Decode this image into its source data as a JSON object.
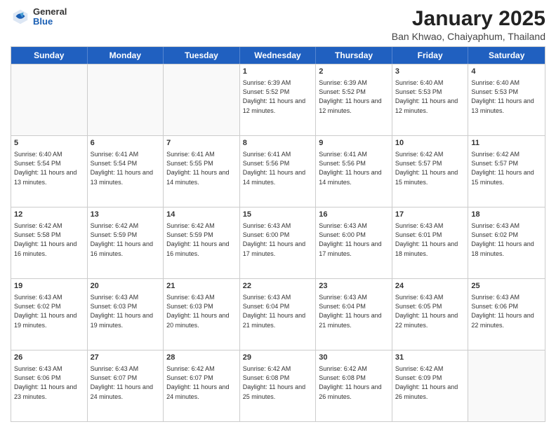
{
  "header": {
    "logo": {
      "general": "General",
      "blue": "Blue"
    },
    "title": "January 2025",
    "location": "Ban Khwao, Chaiyaphum, Thailand"
  },
  "days_of_week": [
    "Sunday",
    "Monday",
    "Tuesday",
    "Wednesday",
    "Thursday",
    "Friday",
    "Saturday"
  ],
  "weeks": [
    [
      {
        "day": "",
        "empty": true
      },
      {
        "day": "",
        "empty": true
      },
      {
        "day": "",
        "empty": true
      },
      {
        "day": "1",
        "sunrise": "Sunrise: 6:39 AM",
        "sunset": "Sunset: 5:52 PM",
        "daylight": "Daylight: 11 hours and 12 minutes."
      },
      {
        "day": "2",
        "sunrise": "Sunrise: 6:39 AM",
        "sunset": "Sunset: 5:52 PM",
        "daylight": "Daylight: 11 hours and 12 minutes."
      },
      {
        "day": "3",
        "sunrise": "Sunrise: 6:40 AM",
        "sunset": "Sunset: 5:53 PM",
        "daylight": "Daylight: 11 hours and 12 minutes."
      },
      {
        "day": "4",
        "sunrise": "Sunrise: 6:40 AM",
        "sunset": "Sunset: 5:53 PM",
        "daylight": "Daylight: 11 hours and 13 minutes."
      }
    ],
    [
      {
        "day": "5",
        "sunrise": "Sunrise: 6:40 AM",
        "sunset": "Sunset: 5:54 PM",
        "daylight": "Daylight: 11 hours and 13 minutes."
      },
      {
        "day": "6",
        "sunrise": "Sunrise: 6:41 AM",
        "sunset": "Sunset: 5:54 PM",
        "daylight": "Daylight: 11 hours and 13 minutes."
      },
      {
        "day": "7",
        "sunrise": "Sunrise: 6:41 AM",
        "sunset": "Sunset: 5:55 PM",
        "daylight": "Daylight: 11 hours and 14 minutes."
      },
      {
        "day": "8",
        "sunrise": "Sunrise: 6:41 AM",
        "sunset": "Sunset: 5:56 PM",
        "daylight": "Daylight: 11 hours and 14 minutes."
      },
      {
        "day": "9",
        "sunrise": "Sunrise: 6:41 AM",
        "sunset": "Sunset: 5:56 PM",
        "daylight": "Daylight: 11 hours and 14 minutes."
      },
      {
        "day": "10",
        "sunrise": "Sunrise: 6:42 AM",
        "sunset": "Sunset: 5:57 PM",
        "daylight": "Daylight: 11 hours and 15 minutes."
      },
      {
        "day": "11",
        "sunrise": "Sunrise: 6:42 AM",
        "sunset": "Sunset: 5:57 PM",
        "daylight": "Daylight: 11 hours and 15 minutes."
      }
    ],
    [
      {
        "day": "12",
        "sunrise": "Sunrise: 6:42 AM",
        "sunset": "Sunset: 5:58 PM",
        "daylight": "Daylight: 11 hours and 16 minutes."
      },
      {
        "day": "13",
        "sunrise": "Sunrise: 6:42 AM",
        "sunset": "Sunset: 5:59 PM",
        "daylight": "Daylight: 11 hours and 16 minutes."
      },
      {
        "day": "14",
        "sunrise": "Sunrise: 6:42 AM",
        "sunset": "Sunset: 5:59 PM",
        "daylight": "Daylight: 11 hours and 16 minutes."
      },
      {
        "day": "15",
        "sunrise": "Sunrise: 6:43 AM",
        "sunset": "Sunset: 6:00 PM",
        "daylight": "Daylight: 11 hours and 17 minutes."
      },
      {
        "day": "16",
        "sunrise": "Sunrise: 6:43 AM",
        "sunset": "Sunset: 6:00 PM",
        "daylight": "Daylight: 11 hours and 17 minutes."
      },
      {
        "day": "17",
        "sunrise": "Sunrise: 6:43 AM",
        "sunset": "Sunset: 6:01 PM",
        "daylight": "Daylight: 11 hours and 18 minutes."
      },
      {
        "day": "18",
        "sunrise": "Sunrise: 6:43 AM",
        "sunset": "Sunset: 6:02 PM",
        "daylight": "Daylight: 11 hours and 18 minutes."
      }
    ],
    [
      {
        "day": "19",
        "sunrise": "Sunrise: 6:43 AM",
        "sunset": "Sunset: 6:02 PM",
        "daylight": "Daylight: 11 hours and 19 minutes."
      },
      {
        "day": "20",
        "sunrise": "Sunrise: 6:43 AM",
        "sunset": "Sunset: 6:03 PM",
        "daylight": "Daylight: 11 hours and 19 minutes."
      },
      {
        "day": "21",
        "sunrise": "Sunrise: 6:43 AM",
        "sunset": "Sunset: 6:03 PM",
        "daylight": "Daylight: 11 hours and 20 minutes."
      },
      {
        "day": "22",
        "sunrise": "Sunrise: 6:43 AM",
        "sunset": "Sunset: 6:04 PM",
        "daylight": "Daylight: 11 hours and 21 minutes."
      },
      {
        "day": "23",
        "sunrise": "Sunrise: 6:43 AM",
        "sunset": "Sunset: 6:04 PM",
        "daylight": "Daylight: 11 hours and 21 minutes."
      },
      {
        "day": "24",
        "sunrise": "Sunrise: 6:43 AM",
        "sunset": "Sunset: 6:05 PM",
        "daylight": "Daylight: 11 hours and 22 minutes."
      },
      {
        "day": "25",
        "sunrise": "Sunrise: 6:43 AM",
        "sunset": "Sunset: 6:06 PM",
        "daylight": "Daylight: 11 hours and 22 minutes."
      }
    ],
    [
      {
        "day": "26",
        "sunrise": "Sunrise: 6:43 AM",
        "sunset": "Sunset: 6:06 PM",
        "daylight": "Daylight: 11 hours and 23 minutes."
      },
      {
        "day": "27",
        "sunrise": "Sunrise: 6:43 AM",
        "sunset": "Sunset: 6:07 PM",
        "daylight": "Daylight: 11 hours and 24 minutes."
      },
      {
        "day": "28",
        "sunrise": "Sunrise: 6:42 AM",
        "sunset": "Sunset: 6:07 PM",
        "daylight": "Daylight: 11 hours and 24 minutes."
      },
      {
        "day": "29",
        "sunrise": "Sunrise: 6:42 AM",
        "sunset": "Sunset: 6:08 PM",
        "daylight": "Daylight: 11 hours and 25 minutes."
      },
      {
        "day": "30",
        "sunrise": "Sunrise: 6:42 AM",
        "sunset": "Sunset: 6:08 PM",
        "daylight": "Daylight: 11 hours and 26 minutes."
      },
      {
        "day": "31",
        "sunrise": "Sunrise: 6:42 AM",
        "sunset": "Sunset: 6:09 PM",
        "daylight": "Daylight: 11 hours and 26 minutes."
      },
      {
        "day": "",
        "empty": true
      }
    ]
  ]
}
